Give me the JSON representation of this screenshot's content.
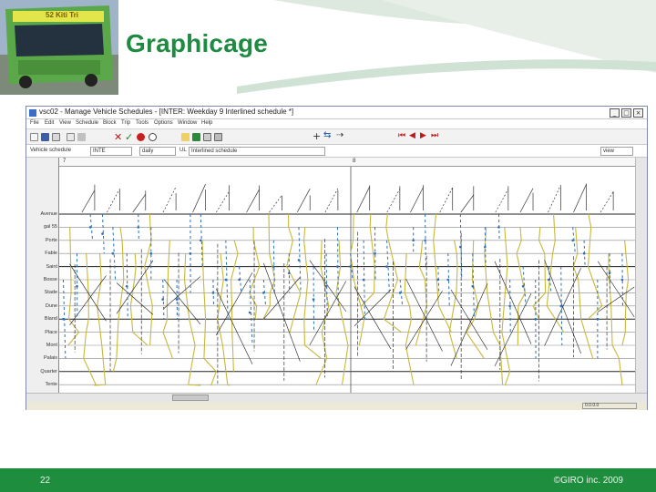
{
  "slide": {
    "title": "Graphicage",
    "number": "22",
    "copyright": "©GIRO inc. 2009",
    "bus_sign": "52 Kiti Tri",
    "brand_color": "#1f8a42",
    "footer_color": "#1e8e3e"
  },
  "window": {
    "title": "vsc02 - Manage Vehicle Schedules - [INTER: Weekday 9 Interlined schedule *]",
    "menu": [
      "File",
      "Edit",
      "View",
      "Schedule",
      "Block",
      "Trip",
      "Tools",
      "Options",
      "Window",
      "Help"
    ],
    "minimize": "_",
    "maximize": "□",
    "close": "×"
  },
  "fields": {
    "schedule_label": "Vehicle schedule",
    "schedule_code": "INTE",
    "day_value": "daily",
    "type_code": "UL",
    "description": "Interlined schedule",
    "right_value": "view"
  },
  "ruler": {
    "labels": [
      "7",
      "8"
    ]
  },
  "stops": [
    "Avenue",
    "gal 55",
    "Porte",
    "Fable",
    "Saint",
    "Bosse",
    "Stade",
    "Dune",
    "Bland",
    "Place",
    "Mont",
    "Palais",
    "Quarter",
    "Tente"
  ],
  "status": {
    "value": "0.0.0.0"
  },
  "toolbar": {
    "icons": [
      "new-icon",
      "save-icon",
      "copy-icon",
      "paste-icon",
      "cut-icon",
      "delete-icon",
      "check-icon",
      "stop-icon",
      "clock-icon",
      "zoom-icon",
      "print-icon",
      "undo-icon",
      "redo-icon",
      "add-icon",
      "move-icon",
      "link-icon",
      "first-icon",
      "prev-icon",
      "next-icon",
      "last-icon"
    ]
  },
  "chart_colors": {
    "tan": "#c8b83a",
    "blue": "#2a6fb8",
    "black": "#1a1a1a",
    "dark": "#333333"
  }
}
